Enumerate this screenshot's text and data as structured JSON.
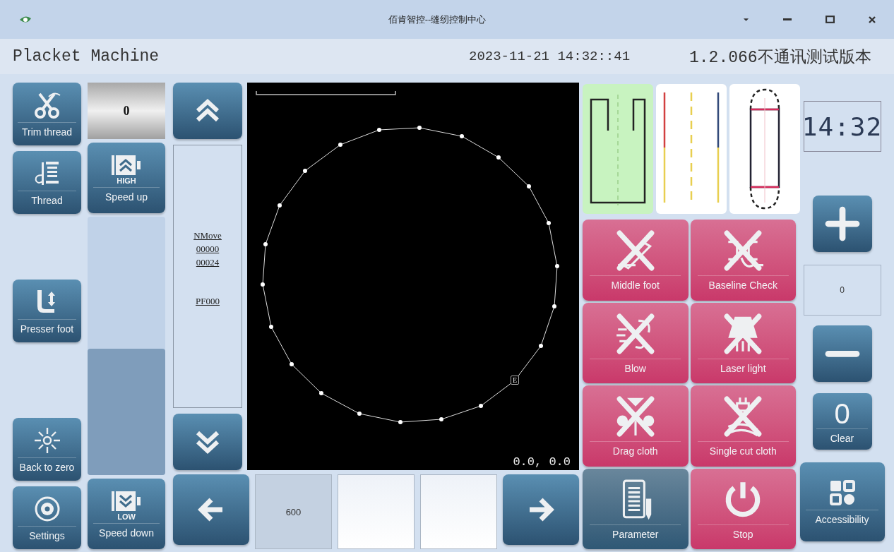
{
  "window": {
    "title": "佰肯智控--缝纫控制中心"
  },
  "header": {
    "machine": "Placket Machine",
    "datetime": "2023-11-21 14:32::41",
    "version": "1.2.066不通讯测试版本"
  },
  "tool_buttons": [
    {
      "kind": "scissors",
      "label": "Trim thread"
    },
    {
      "kind": "spool",
      "label": "Thread"
    },
    {
      "kind": "presser",
      "label": "Presser foot"
    },
    {
      "kind": "zero",
      "label": "Back to zero"
    },
    {
      "kind": "gear",
      "label": "Settings"
    }
  ],
  "speed": {
    "counter": "0",
    "up": {
      "badge": "HIGH",
      "label": "Speed up"
    },
    "level": 0.49,
    "down": {
      "badge": "LOW",
      "label": "Speed down"
    }
  },
  "info_panel": {
    "lines": [
      "NMove",
      "00000",
      "00024",
      "PF000"
    ]
  },
  "canvas": {
    "end_marker": "E",
    "coordinates": "0.0, 0.0"
  },
  "bottom_field": {
    "value": "600"
  },
  "patterns": [
    {
      "kind": "open-rect",
      "selected": true
    },
    {
      "kind": "lines",
      "selected": false
    },
    {
      "kind": "capsule",
      "selected": false
    }
  ],
  "function_buttons": [
    {
      "kind": "middle-foot",
      "label": "Middle foot",
      "on": false,
      "color": "#c9386a"
    },
    {
      "kind": "baseline",
      "label": "Baseline Check",
      "on": false,
      "color": "#c9386a"
    },
    {
      "kind": "blow",
      "label": "Blow",
      "on": false,
      "color": "#c9386a"
    },
    {
      "kind": "laser",
      "label": "Laser light",
      "on": false,
      "color": "#c9386a"
    },
    {
      "kind": "drag",
      "label": "Drag cloth",
      "on": false,
      "color": "#c9386a"
    },
    {
      "kind": "cut",
      "label": "Single cut cloth",
      "on": false,
      "color": "#c9386a"
    },
    {
      "kind": "parameter",
      "label": "Parameter",
      "on": true,
      "color": "#2f5875"
    },
    {
      "kind": "power",
      "label": "Stop",
      "on": true,
      "color": "#c9386a"
    }
  ],
  "side_panel": {
    "clock": "14:32",
    "value": "0",
    "clear": {
      "digit": "0",
      "label": "Clear"
    },
    "accessibility": "Accessibility"
  }
}
